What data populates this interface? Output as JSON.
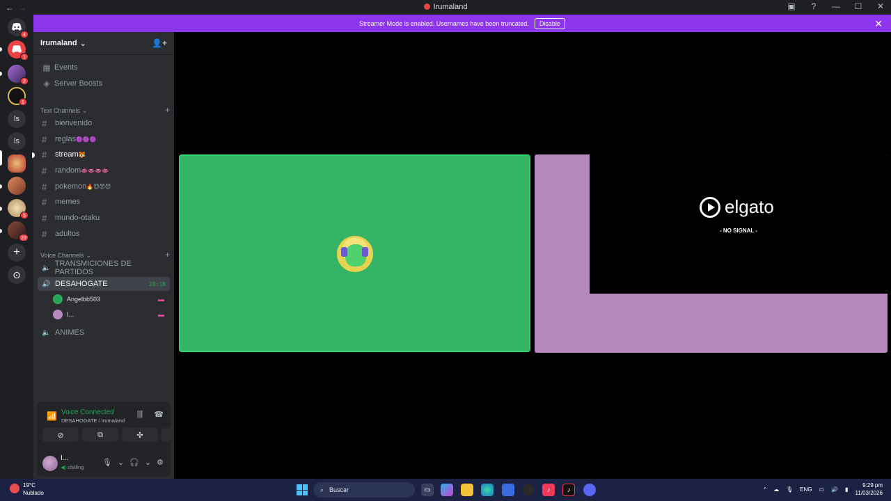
{
  "window": {
    "title": "Irumaland",
    "back": "←",
    "forward": "→"
  },
  "banner": {
    "text": "Streamer Mode is enabled. Usernames have been truncated.",
    "button": "Disable",
    "close": "✕"
  },
  "rail": {
    "servers": [
      {
        "name": "dm",
        "badge": "4",
        "color": "#5865f2",
        "label": ""
      },
      {
        "name": "server-1",
        "badge": "1",
        "color": "#ed4245",
        "label": ""
      },
      {
        "name": "server-2",
        "badge": "2",
        "color": "#7a4fa3",
        "label": ""
      },
      {
        "name": "server-3",
        "badge": "1",
        "color": "#3a3a3a",
        "label": ""
      },
      {
        "name": "server-ls-1",
        "badge": "",
        "color": "#313338",
        "label": "ls"
      },
      {
        "name": "server-ls-2",
        "badge": "",
        "color": "#313338",
        "label": "ls"
      },
      {
        "name": "server-irumaland",
        "badge": "",
        "color": "#c2452f",
        "label": ""
      },
      {
        "name": "server-4",
        "badge": "",
        "color": "#b5583b",
        "label": ""
      },
      {
        "name": "server-5",
        "badge": "5",
        "color": "#c8a77a",
        "label": ""
      },
      {
        "name": "server-6",
        "badge": "22",
        "color": "#6a3f3a",
        "label": ""
      }
    ],
    "add": "+",
    "discover": "⊙"
  },
  "sidebar": {
    "guild": "Irumaland",
    "top_items": [
      {
        "label": "Events",
        "icon": "calendar-icon"
      },
      {
        "label": "Server Boosts",
        "icon": "boost-icon"
      }
    ],
    "text_category": "Text Channels",
    "text_channels": [
      {
        "name": "bienvenido",
        "emoji": ""
      },
      {
        "name": "reglas",
        "emoji": "🟣🟣🟣"
      },
      {
        "name": "stream",
        "emoji": "🐯"
      },
      {
        "name": "random",
        "emoji": "👄👄👄👄"
      },
      {
        "name": "pokemon",
        "emoji": "🔥😈😈😈"
      },
      {
        "name": "memes",
        "emoji": ""
      },
      {
        "name": "mundo-otaku",
        "emoji": ""
      },
      {
        "name": "adultos",
        "emoji": ""
      }
    ],
    "voice_category": "Voice Channels",
    "voice_channels": [
      {
        "name": "TRANSMICIONES DE PARTIDOS"
      },
      {
        "name": "DESAHOGATE",
        "timer": "28:18"
      },
      {
        "name": "ANIMES"
      }
    ],
    "voice_users": [
      {
        "name": "Angelbb503",
        "live": "▬"
      },
      {
        "name": "I...",
        "live": "▬"
      }
    ]
  },
  "voice_panel": {
    "status": "Voice Connected",
    "location": "DESAHOGATE / Irumaland",
    "user": "I...",
    "user_status": "chilling"
  },
  "stage": {
    "elgato_brand": "elgato",
    "no_signal": "- NO SIGNAL -"
  },
  "taskbar": {
    "temp": "19°C",
    "weather": "Nublado",
    "search": "Buscar",
    "lang": "ENG",
    "time": "9:29 pm",
    "date": "11/03/2026"
  }
}
